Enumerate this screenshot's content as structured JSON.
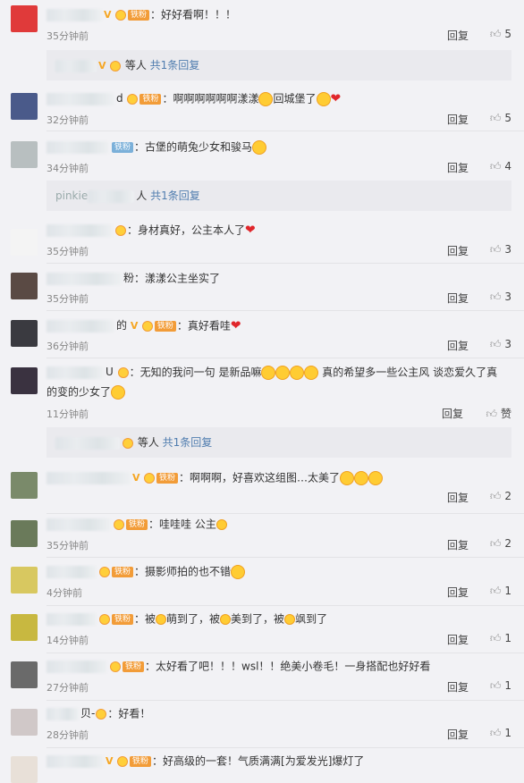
{
  "actions": {
    "reply": "回复",
    "like_placeholder": "赞"
  },
  "comments": [
    {
      "name_suffix": "",
      "badge": "铁粉",
      "badge_color": "orange",
      "text": "：好好看啊！！！",
      "time": "35分钟前",
      "likes": "5",
      "avatar_color": "#e03a3a",
      "sub": {
        "label": "等人",
        "link": "共1条回复"
      }
    },
    {
      "name_suffix": "d",
      "badge": "铁粉",
      "badge_color": "orange",
      "text": "：啊啊啊啊啊啊漾漾",
      "text2": "回城堡了",
      "time": "32分钟前",
      "likes": "5",
      "avatar_color": "#4a5a8a"
    },
    {
      "name_suffix": "",
      "badge": "铁粉",
      "badge_color": "blue",
      "text": "：古堡的萌兔少女和骏马",
      "time": "34分钟前",
      "likes": "4",
      "avatar_color": "#b8bfc0",
      "sub": {
        "label": "人",
        "prefix": "pinkie",
        "link": "共1条回复"
      }
    },
    {
      "name_suffix": "",
      "badge": "",
      "badge_color": "orange",
      "text": "：身材真好，公主本人了",
      "time": "35分钟前",
      "likes": "3",
      "avatar_color": "#f4f4f4"
    },
    {
      "name_suffix": "粉",
      "badge": "",
      "badge_color": "orange",
      "text": "：漾漾公主坐实了",
      "time": "35分钟前",
      "likes": "3",
      "avatar_color": "#5a4a44"
    },
    {
      "name_suffix": "的",
      "badge": "铁粉",
      "badge_color": "orange",
      "text": "：真好看哇",
      "time": "36分钟前",
      "likes": "3",
      "avatar_color": "#3a3a40"
    },
    {
      "name_suffix": "U",
      "badge": "",
      "badge_color": "orange",
      "text": "：无知的我问一句 是新品嘛",
      "text2": "真的希望多一些公主风 谈恋爱久了真",
      "line2": "的变的少女了",
      "time": "11分钟前",
      "likes": "赞",
      "avatar_color": "#3a3240",
      "sub": {
        "label": "等人",
        "link": "共1条回复"
      }
    },
    {
      "name_suffix": "",
      "badge": "铁粉",
      "badge_color": "orange",
      "text": "：啊啊啊，好喜欢这组图…太美了",
      "time": "",
      "likes": "2",
      "avatar_color": "#7a8a6a"
    },
    {
      "name_suffix": "",
      "badge": "铁粉",
      "badge_color": "orange",
      "text": "：哇哇哇  公主",
      "time": "35分钟前",
      "likes": "2",
      "avatar_color": "#6a7a5a"
    },
    {
      "name_suffix": "",
      "badge": "铁粉",
      "badge_color": "orange",
      "text": "：摄影师拍的也不错",
      "time": "4分钟前",
      "likes": "1",
      "avatar_color": "#d8c860"
    },
    {
      "name_suffix": "",
      "badge": "铁粉",
      "badge_color": "orange",
      "text": "：被",
      "text2": "萌到了，被",
      "text3": "美到了，被",
      "text4": "飒到了",
      "time": "14分钟前",
      "likes": "1",
      "avatar_color": "#c8b840"
    },
    {
      "name_suffix": "",
      "badge": "铁粉",
      "badge_color": "orange",
      "text": "：太好看了吧！！！wsl！！绝美小卷毛！一身搭配也好好看",
      "time": "27分钟前",
      "likes": "1",
      "avatar_color": "#6a6a6a"
    },
    {
      "name_suffix": "贝-",
      "badge": "",
      "badge_color": "orange",
      "text": "：好看！",
      "time": "28分钟前",
      "likes": "1",
      "avatar_color": "#d0c8c8"
    },
    {
      "name_suffix": "",
      "badge": "铁粉",
      "badge_color": "orange",
      "text": "：好高级的一套！气质满满[为爱发光]爆灯了",
      "time": "",
      "likes": "",
      "avatar_color": "#e8e0d8"
    }
  ]
}
